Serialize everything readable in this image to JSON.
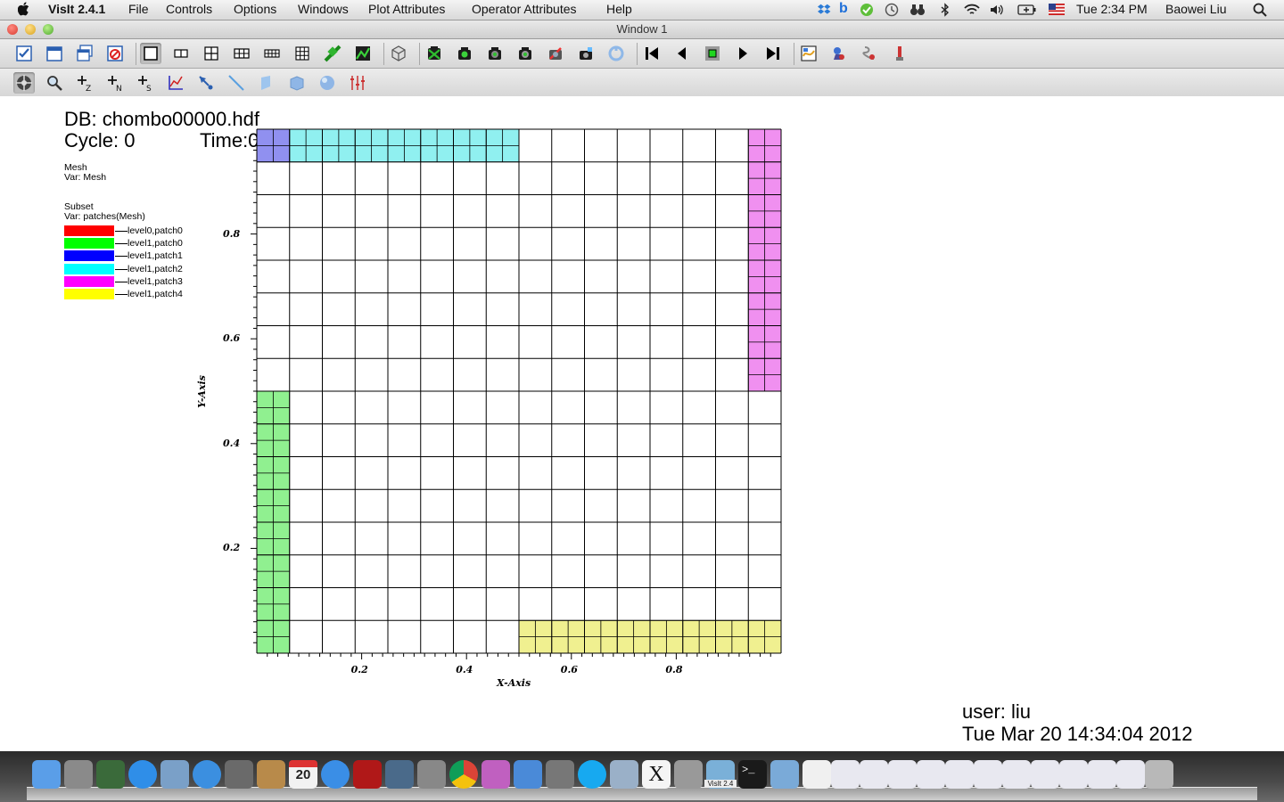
{
  "menubar": {
    "app_name": "VisIt 2.4.1",
    "items": [
      "File",
      "Controls",
      "Options",
      "Windows",
      "Plot Attributes",
      "Operator Attributes",
      "Help"
    ],
    "clock": "Tue 2:34 PM",
    "user": "Baowei Liu"
  },
  "window": {
    "title": "Window 1"
  },
  "toolbar1": {
    "icons": [
      "apply-icon",
      "new-window-icon",
      "clone-window-icon",
      "delete-window-icon",
      "layout-1x1-icon",
      "layout-1x2-icon",
      "layout-2x2-icon",
      "layout-2x3-icon",
      "layout-2x4-icon",
      "layout-3x3-icon",
      "lock-view-icon",
      "lock-time-icon",
      "spin-mode-icon",
      "add-plot-icon",
      "draw-plots-icon",
      "hide-plots-icon",
      "delete-plots-icon",
      "save-image-icon",
      "print-icon",
      "reopen-icon",
      "first-frame-icon",
      "prev-frame-icon",
      "stop-icon",
      "play-icon",
      "last-frame-icon",
      "set-plot-icon",
      "pick-icon",
      "invert-icon",
      "clear-icon"
    ]
  },
  "toolbar2": {
    "icons": [
      "navigate-icon",
      "zoom-icon",
      "zone-pick-icon",
      "node-pick-icon",
      "surface-pick-icon",
      "line-out-icon",
      "point-tool-icon",
      "line-tool-icon",
      "plane-tool-icon",
      "box-tool-icon",
      "sphere-tool-icon",
      "axis-restrict-icon"
    ]
  },
  "annotations": {
    "db_label": "DB: chombo00000.hdf",
    "cycle_label": "Cycle: 0",
    "time_label": "Time:0",
    "mesh_title": "Mesh",
    "mesh_var": "Var: Mesh",
    "subset_title": "Subset",
    "subset_var": "Var: patches(Mesh)",
    "legend": [
      {
        "label": "level0,patch0",
        "color": "#ff0000"
      },
      {
        "label": "level1,patch0",
        "color": "#00ff00"
      },
      {
        "label": "level1,patch1",
        "color": "#0000ff"
      },
      {
        "label": "level1,patch2",
        "color": "#00ffff"
      },
      {
        "label": "level1,patch3",
        "color": "#ff00ff"
      },
      {
        "label": "level1,patch4",
        "color": "#ffff00"
      }
    ],
    "user_label": "user: liu",
    "date_label": "Tue Mar 20 14:34:04 2012"
  },
  "chart_data": {
    "type": "heatmap",
    "title": "",
    "xlabel": "X-Axis",
    "ylabel": "Y-Axis",
    "xlim": [
      0,
      1
    ],
    "ylim": [
      0,
      1
    ],
    "x_ticks": [
      "0.2",
      "0.4",
      "0.6",
      "0.8"
    ],
    "y_ticks": [
      "0.2",
      "0.4",
      "0.6",
      "0.8"
    ],
    "coarse_grid": [
      16,
      16
    ],
    "patches": [
      {
        "name": "level0,patch0",
        "x": [
          0,
          1
        ],
        "y": [
          0,
          1
        ],
        "color": "#ffffff",
        "refined": false
      },
      {
        "name": "level1,patch0",
        "x": [
          0,
          0.0625
        ],
        "y": [
          0,
          0.5
        ],
        "color": "#90f090",
        "refined": true
      },
      {
        "name": "level1,patch1",
        "x": [
          0,
          0.0625
        ],
        "y": [
          0.9375,
          1
        ],
        "color": "#9090f0",
        "refined": true
      },
      {
        "name": "level1,patch2",
        "x": [
          0.0625,
          0.5
        ],
        "y": [
          0.9375,
          1
        ],
        "color": "#90f0f0",
        "refined": true
      },
      {
        "name": "level1,patch3",
        "x": [
          0.9375,
          1
        ],
        "y": [
          0.5,
          1
        ],
        "color": "#f090f0",
        "refined": true
      },
      {
        "name": "level1,patch4",
        "x": [
          0.5,
          1
        ],
        "y": [
          0,
          0.0625
        ],
        "color": "#f0f090",
        "refined": true
      }
    ]
  },
  "dock": {
    "icons": [
      "finder-icon",
      "launchpad-icon",
      "mission-control-icon",
      "app-store-icon",
      "mail-stamp-icon",
      "safari-icon",
      "facetime-icon",
      "contacts-icon",
      "calendar-icon",
      "itunes-icon",
      "photo-booth-icon",
      "iphoto-icon",
      "system-preferences-icon",
      "chrome-icon",
      "messages-icon",
      "word-icon",
      "utilities-icon",
      "skype-icon",
      "preview-icon",
      "x11-icon",
      "calculator-icon",
      "visit-icon",
      "terminal-icon",
      "folder-icon",
      "document-icon",
      "window-thumb-icon",
      "window-thumb-icon",
      "window-thumb-icon",
      "window-thumb-icon",
      "window-thumb-icon",
      "window-thumb-icon",
      "window-thumb-icon",
      "window-thumb-icon",
      "window-thumb-icon",
      "window-thumb-icon",
      "window-thumb-icon",
      "trash-icon"
    ],
    "calendar_day": "20",
    "visit_label": "VisIt 2.4"
  }
}
